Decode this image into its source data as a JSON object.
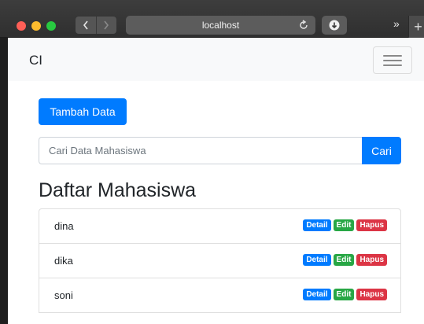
{
  "browser": {
    "url": "localhost",
    "more_label": "»",
    "new_tab_label": "+"
  },
  "navbar": {
    "brand": "CI"
  },
  "main": {
    "add_button": "Tambah Data",
    "search": {
      "placeholder": "Cari Data Mahasiswa",
      "button": "Cari"
    },
    "heading": "Daftar Mahasiswa",
    "students": [
      {
        "name": "dina",
        "detail": "Detail",
        "edit": "Edit",
        "delete": "Hapus"
      },
      {
        "name": "dika",
        "detail": "Detail",
        "edit": "Edit",
        "delete": "Hapus"
      },
      {
        "name": "soni",
        "detail": "Detail",
        "edit": "Edit",
        "delete": "Hapus"
      }
    ]
  },
  "colors": {
    "primary": "#007bff",
    "success": "#28a745",
    "danger": "#dc3545"
  }
}
